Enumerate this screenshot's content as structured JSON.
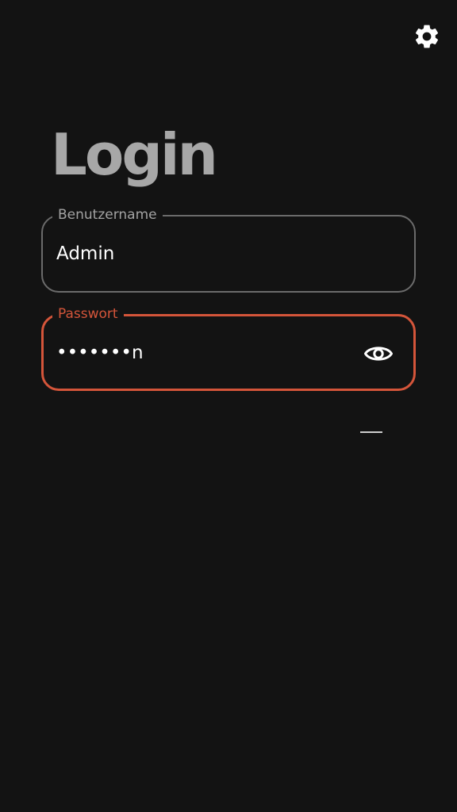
{
  "header": {
    "settings_icon": "gear-icon"
  },
  "login": {
    "title": "Login",
    "username": {
      "label": "Benutzername",
      "value": "Admin"
    },
    "password": {
      "label": "Passwort",
      "value": "•••••••n",
      "toggle_icon": "eye-icon"
    }
  },
  "colors": {
    "background": "#131313",
    "title": "#a7a7a7",
    "accent_error": "#d4553a",
    "field_border": "#6b6b6b",
    "text": "#ffffff"
  }
}
